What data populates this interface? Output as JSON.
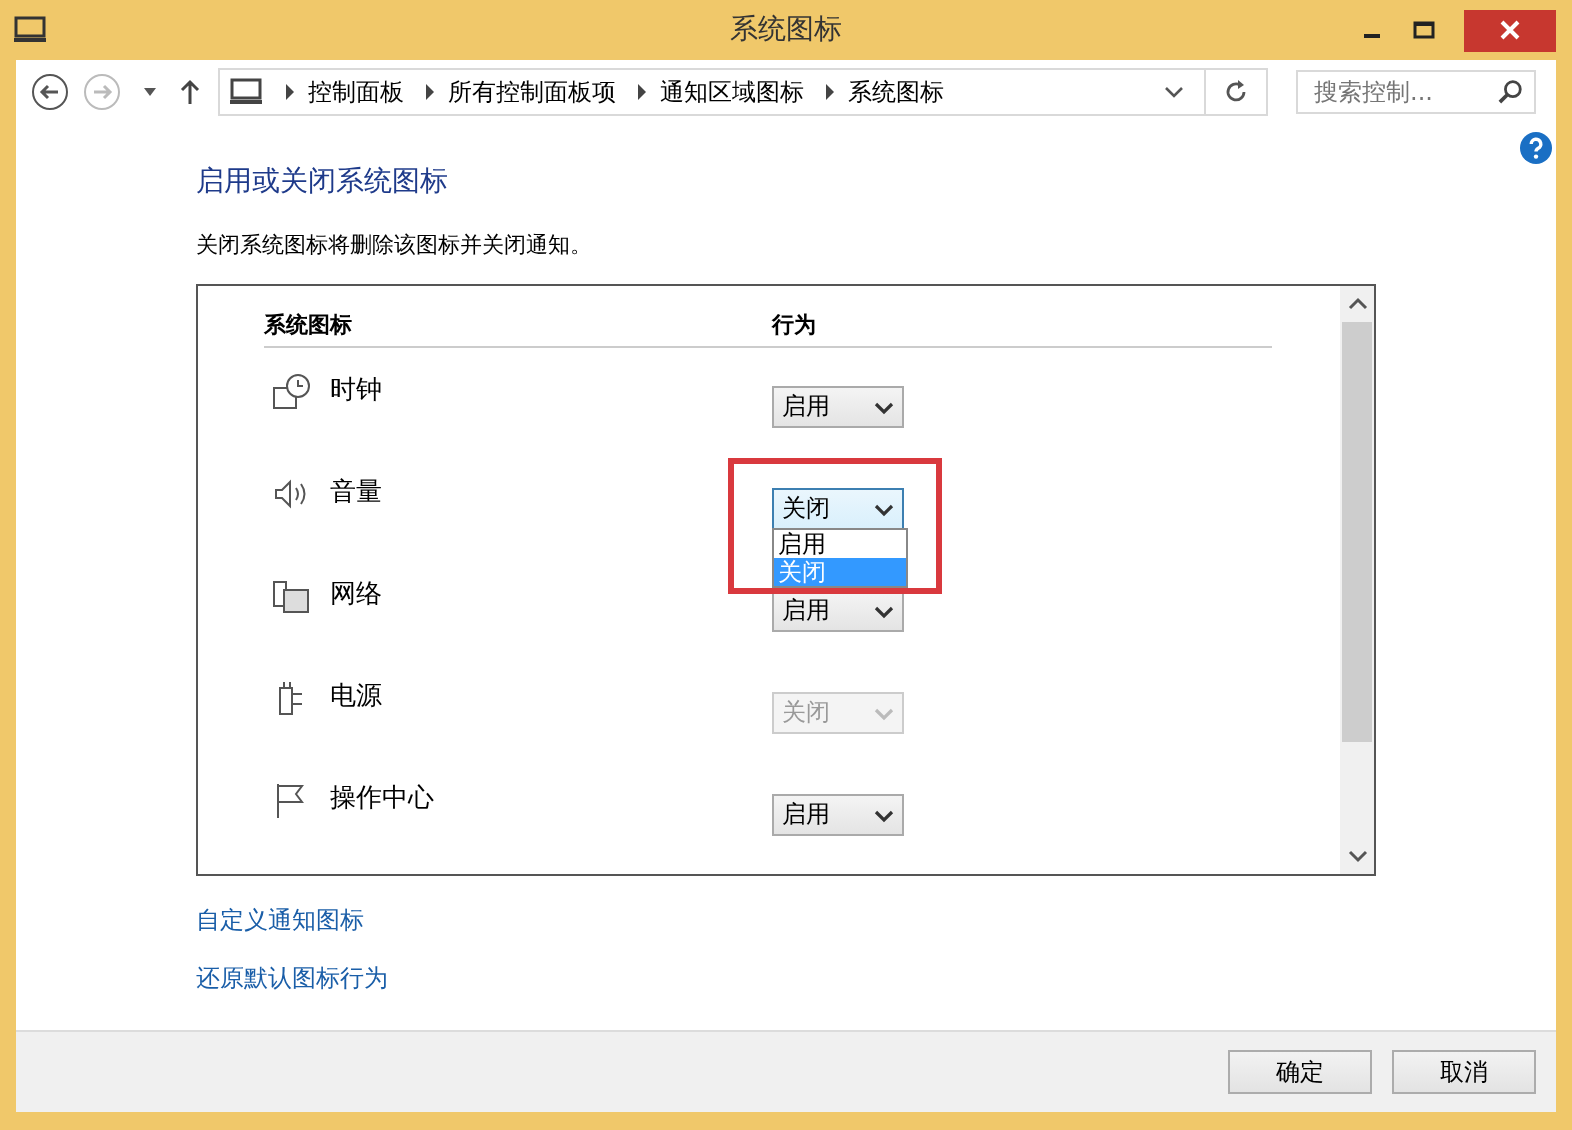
{
  "window": {
    "title": "系统图标"
  },
  "breadcrumb": [
    "控制面板",
    "所有控制面板项",
    "通知区域图标",
    "系统图标"
  ],
  "search": {
    "placeholder": "搜索控制..."
  },
  "heading": "启用或关闭系统图标",
  "description": "关闭系统图标将删除该图标并关闭通知。",
  "table": {
    "columns": [
      "系统图标",
      "行为"
    ],
    "rows": [
      {
        "kind": "clock",
        "name": "时钟",
        "value": "启用",
        "disabled": false,
        "expanded": false
      },
      {
        "kind": "volume",
        "name": "音量",
        "value": "关闭",
        "disabled": false,
        "expanded": true,
        "options": [
          {
            "label": "启用",
            "selected": false
          },
          {
            "label": "关闭",
            "selected": true
          }
        ]
      },
      {
        "kind": "network",
        "name": "网络",
        "value": "启用",
        "disabled": false,
        "expanded": false
      },
      {
        "kind": "power",
        "name": "电源",
        "value": "关闭",
        "disabled": true,
        "expanded": false
      },
      {
        "kind": "flag",
        "name": "操作中心",
        "value": "启用",
        "disabled": false,
        "expanded": false
      }
    ]
  },
  "links": [
    "自定义通知图标",
    "还原默认图标行为"
  ],
  "buttons": [
    "确定",
    "取消"
  ]
}
